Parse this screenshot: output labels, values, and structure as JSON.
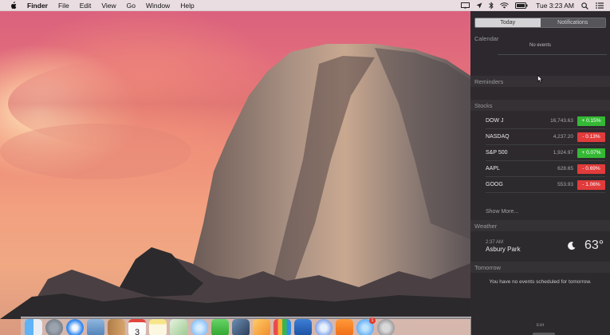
{
  "menubar": {
    "app_name": "Finder",
    "menus": [
      "File",
      "Edit",
      "View",
      "Go",
      "Window",
      "Help"
    ],
    "clock": "Tue 3:23 AM",
    "status_icons": [
      "display-mirroring-icon",
      "location-arrow-icon",
      "bluetooth-icon",
      "wifi-icon",
      "battery-icon"
    ]
  },
  "notification_center": {
    "tabs": {
      "today": "Today",
      "notifications": "Notifications",
      "active": "Today"
    },
    "calendar": {
      "title": "Calendar",
      "message": "No events"
    },
    "reminders": {
      "title": "Reminders"
    },
    "stocks": {
      "title": "Stocks",
      "rows": [
        {
          "symbol": "DOW J",
          "price": "16,743.63",
          "change": "+ 0.15%",
          "direction": "up"
        },
        {
          "symbol": "NASDAQ",
          "price": "4,237.20",
          "change": "- 0.13%",
          "direction": "down"
        },
        {
          "symbol": "S&P 500",
          "price": "1,924.97",
          "change": "+ 0.07%",
          "direction": "up"
        },
        {
          "symbol": "AAPL",
          "price": "628.65",
          "change": "- 0.69%",
          "direction": "down"
        },
        {
          "symbol": "GOOG",
          "price": "553.93",
          "change": "- 1.06%",
          "direction": "down"
        }
      ],
      "show_more": "Show More..."
    },
    "weather": {
      "title": "Weather",
      "time": "2:37 AM",
      "city": "Asbury Park",
      "temperature": "63°",
      "condition_icon": "moon-icon"
    },
    "tomorrow": {
      "title": "Tomorrow",
      "message": "You have no events scheduled for tomorrow."
    },
    "edit": {
      "label": "Edit"
    },
    "colors": {
      "panel": "#26262a",
      "up": "#35b835",
      "down": "#e13b3b"
    }
  },
  "dock": {
    "calendar_day": "3",
    "apps": [
      "finder-icon",
      "launchpad-icon",
      "safari-icon",
      "preview-icon",
      "contacts-icon",
      "calendar-icon",
      "notes-icon",
      "photos-icon",
      "messages-icon",
      "facetime-icon",
      "photo-booth-icon",
      "pages-icon",
      "numbers-icon",
      "keynote-icon",
      "itunes-icon",
      "ibooks-icon",
      "app-store-icon",
      "system-preferences-icon"
    ],
    "app_store_badge": "1"
  }
}
